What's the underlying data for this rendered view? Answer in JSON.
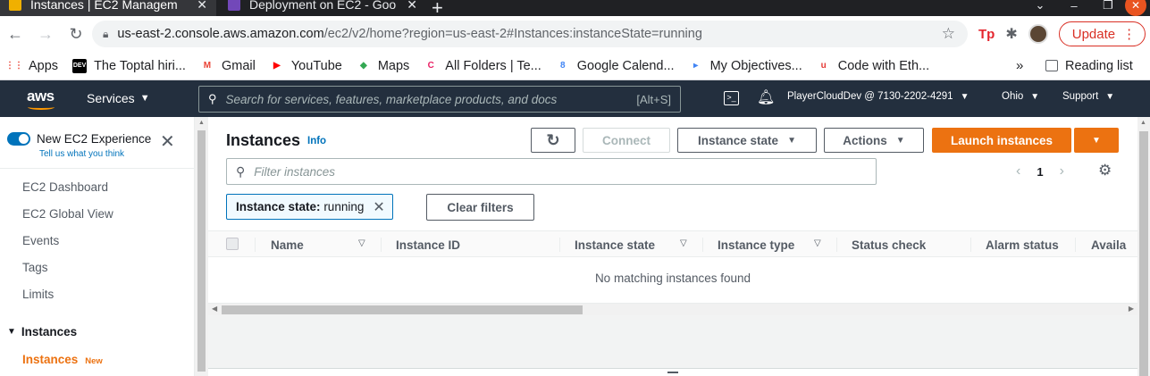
{
  "browser": {
    "tabs": [
      {
        "title": "Instances | EC2 Managem",
        "close": "✕",
        "favicon_color": "#f0b000"
      },
      {
        "title": "Deployment on EC2 - Goo",
        "close": "✕",
        "favicon_color": "#7248b9"
      }
    ],
    "new_tab": "+",
    "window_controls": [
      "⌄",
      "–",
      "❐",
      "✕"
    ],
    "url_host": "us-east-2.console.aws.amazon.com",
    "url_path": "/ec2/v2/home?region=us-east-2#Instances:instanceState=running",
    "update_label": "Update",
    "extension_label": "Tp",
    "bookmarks": [
      {
        "label": "Apps",
        "icon": "apps-grid-icon",
        "icon_color": "#ea4335",
        "glyph": "⋮⋮"
      },
      {
        "label": "The Toptal hiri...",
        "icon": "dev-icon",
        "icon_color": "#000000",
        "glyph": "DEV"
      },
      {
        "label": "Gmail",
        "icon": "gmail-icon",
        "icon_color": "#ea4335",
        "glyph": "M"
      },
      {
        "label": "YouTube",
        "icon": "youtube-icon",
        "icon_color": "#ff0000",
        "glyph": "▶"
      },
      {
        "label": "Maps",
        "icon": "maps-icon",
        "icon_color": "#34a853",
        "glyph": "◆"
      },
      {
        "label": "All Folders | Te...",
        "icon": "folders-icon",
        "icon_color": "#e91e63",
        "glyph": "C"
      },
      {
        "label": "Google Calend...",
        "icon": "calendar-icon",
        "icon_color": "#4285f4",
        "glyph": "8"
      },
      {
        "label": "My Objectives...",
        "icon": "objectives-icon",
        "icon_color": "#4285f4",
        "glyph": "▸"
      },
      {
        "label": "Code with Eth...",
        "icon": "code-icon",
        "icon_color": "#e53935",
        "glyph": "u"
      }
    ],
    "bookmarks_more": "»",
    "reading_list": "Reading list"
  },
  "aws_nav": {
    "logo": "aws",
    "services": "Services",
    "search_placeholder": "Search for services, features, marketplace products, and docs",
    "search_shortcut": "[Alt+S]",
    "account": "PlayerCloudDev @ 7130-2202-4291",
    "region": "Ohio",
    "support": "Support"
  },
  "sidebar": {
    "experience_title": "New EC2 Experience",
    "experience_sub": "Tell us what you think",
    "items": [
      "EC2 Dashboard",
      "EC2 Global View",
      "Events",
      "Tags",
      "Limits"
    ],
    "section": "Instances",
    "active_item": "Instances",
    "active_badge": "New"
  },
  "main": {
    "title": "Instances",
    "info": "Info",
    "connect": "Connect",
    "instance_state_btn": "Instance state",
    "actions_btn": "Actions",
    "launch_btn": "Launch instances",
    "filter_placeholder": "Filter instances",
    "page_number": "1",
    "token_key": "Instance state:",
    "token_value": "running",
    "clear_filters": "Clear filters",
    "columns": [
      "Name",
      "Instance ID",
      "Instance state",
      "Instance type",
      "Status check",
      "Alarm status",
      "Availa"
    ],
    "empty_message": "No matching instances found"
  },
  "colors": {
    "aws_nav_bg": "#232f3e",
    "primary_orange": "#ec7211",
    "link_blue": "#0073bb"
  }
}
